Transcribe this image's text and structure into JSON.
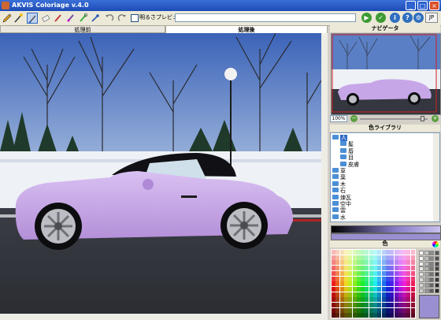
{
  "window": {
    "title": "AKVIS Coloriage v.4.0"
  },
  "toolbar": {
    "tools": [
      "pencil-icon",
      "magic-brush-icon",
      "brush-icon",
      "eraser-icon",
      "color-brush-icon",
      "keep-color-icon",
      "chain-icon",
      "eyedropper-icon",
      "undo-icon",
      "redo-icon"
    ],
    "preview_label": "明るさプレビュー",
    "path_value": "",
    "right_buttons": [
      "run-icon",
      "apply-icon",
      "info-icon",
      "help-icon",
      "preferences-icon"
    ],
    "language": "JP"
  },
  "tabs": {
    "before": "処理前",
    "after": "処理後"
  },
  "navigator": {
    "title": "ナビゲータ",
    "zoom": "100%",
    "zoom_level": 0.95
  },
  "library": {
    "title": "色ライブラリ",
    "items": [
      {
        "label": "人",
        "level": 0,
        "selected": true
      },
      {
        "label": "髪",
        "level": 1
      },
      {
        "label": "唇",
        "level": 1
      },
      {
        "label": "目",
        "level": 1
      },
      {
        "label": "皮膚",
        "level": 1
      },
      {
        "label": "草",
        "level": 0
      },
      {
        "label": "葉",
        "level": 0
      },
      {
        "label": "木",
        "level": 0
      },
      {
        "label": "石",
        "level": 0
      },
      {
        "label": "煉瓦",
        "level": 0
      },
      {
        "label": "空中",
        "level": 0
      },
      {
        "label": "雲",
        "level": 0
      },
      {
        "label": "水",
        "level": 0
      }
    ]
  },
  "colors": {
    "title": "色",
    "current": "#9a8fd0",
    "accent": "#316ac5",
    "car_color": "#c7a6e8"
  }
}
